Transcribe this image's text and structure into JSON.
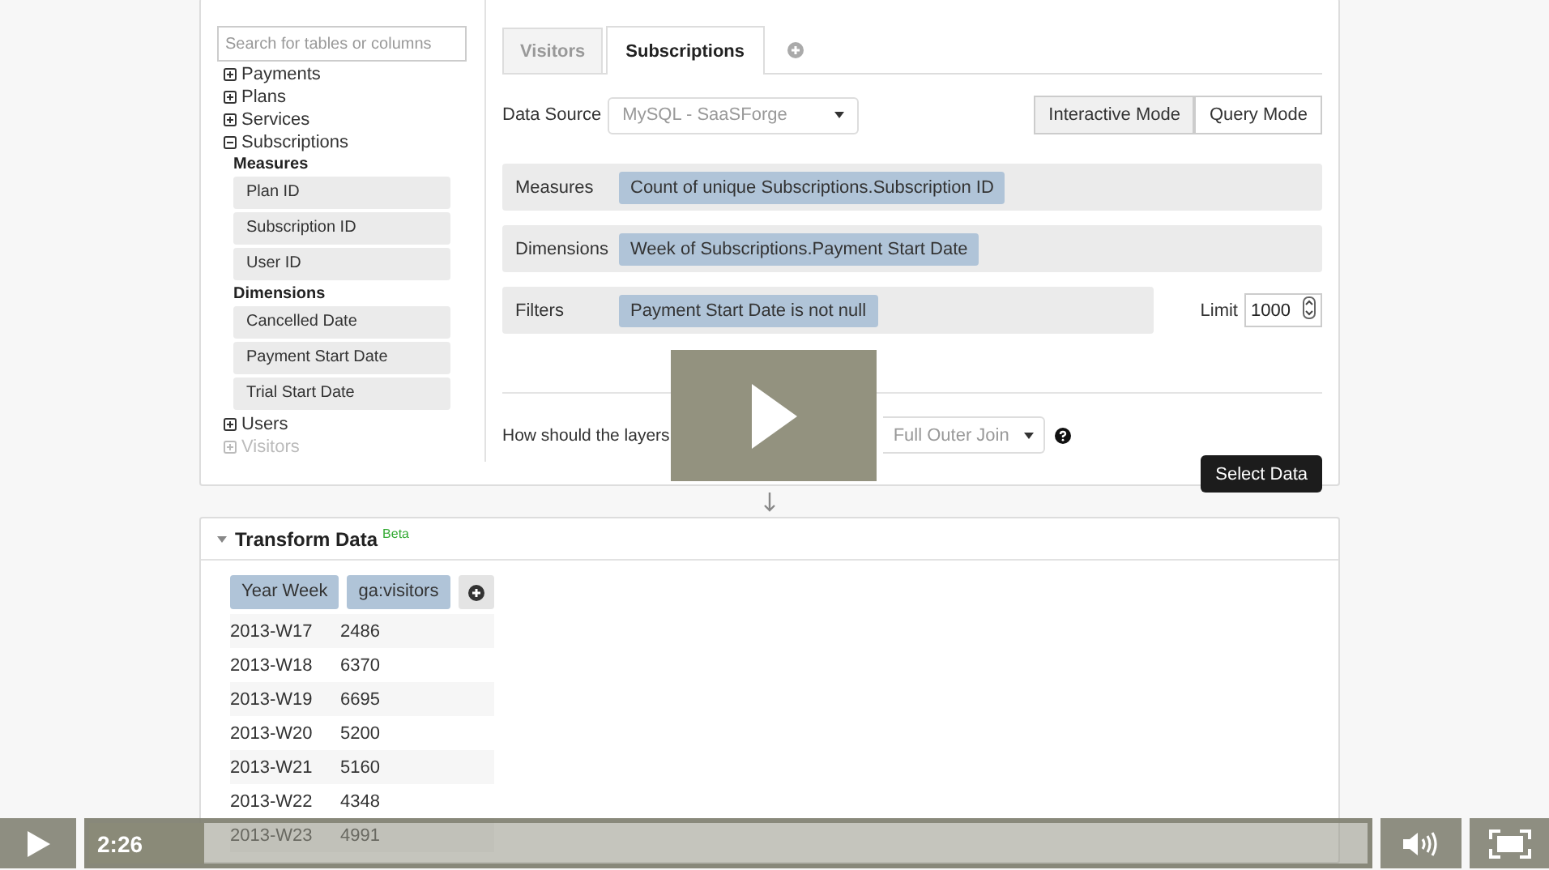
{
  "sidebar": {
    "search": {
      "placeholder": "Search for tables or columns"
    },
    "tables": [
      {
        "label": "Payments",
        "expanded": false,
        "disabled": false
      },
      {
        "label": "Plans",
        "expanded": false,
        "disabled": false
      },
      {
        "label": "Services",
        "expanded": false,
        "disabled": false
      },
      {
        "label": "Subscriptions",
        "expanded": true,
        "disabled": false,
        "groups": [
          {
            "label": "Measures",
            "fields": [
              "Plan ID",
              "Subscription ID",
              "User ID"
            ]
          },
          {
            "label": "Dimensions",
            "fields": [
              "Cancelled Date",
              "Payment Start Date",
              "Trial Start Date"
            ]
          }
        ]
      },
      {
        "label": "Users",
        "expanded": false,
        "disabled": false
      },
      {
        "label": "Visitors",
        "expanded": false,
        "disabled": true
      }
    ]
  },
  "layer_tabs": [
    {
      "label": "Visitors",
      "selected": false
    },
    {
      "label": "Subscriptions",
      "selected": true
    }
  ],
  "data_source": {
    "label": "Data Source",
    "value": "MySQL - SaaSForge"
  },
  "modes": [
    {
      "label": "Interactive Mode",
      "selected": true
    },
    {
      "label": "Query Mode",
      "selected": false
    }
  ],
  "query_rows": [
    {
      "label": "Measures",
      "pills": [
        "Count of unique Subscriptions.Subscription ID"
      ]
    },
    {
      "label": "Dimensions",
      "pills": [
        "Week of Subscriptions.Payment Start Date"
      ]
    },
    {
      "label": "Filters",
      "pills": [
        "Payment Start Date is not null"
      ]
    }
  ],
  "limit": {
    "label": "Limit",
    "value": "1000"
  },
  "merge": {
    "label": "How should the layers",
    "value": "Full Outer Join"
  },
  "select_button": "Select Data",
  "transform": {
    "title": "Transform Data",
    "badge": "Beta",
    "columns": [
      "Year Week",
      "ga:visitors"
    ],
    "rows": [
      [
        "2013-W17",
        "2486"
      ],
      [
        "2013-W18",
        "6370"
      ],
      [
        "2013-W19",
        "6695"
      ],
      [
        "2013-W20",
        "5200"
      ],
      [
        "2013-W21",
        "5160"
      ],
      [
        "2013-W22",
        "4348"
      ],
      [
        "2013-W23",
        "4991"
      ]
    ]
  },
  "player": {
    "time": "2:26",
    "level": 0.09
  }
}
